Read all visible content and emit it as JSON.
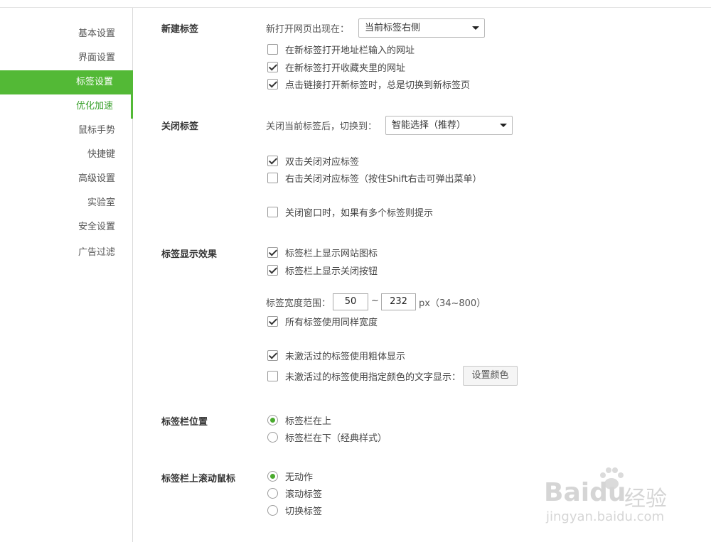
{
  "sidebar": {
    "items": [
      {
        "label": "基本设置"
      },
      {
        "label": "界面设置"
      },
      {
        "label": "标签设置"
      },
      {
        "label": "优化加速"
      },
      {
        "label": "鼠标手势"
      },
      {
        "label": "快捷键"
      },
      {
        "label": "高级设置"
      },
      {
        "label": "实验室"
      },
      {
        "label": "安全设置"
      },
      {
        "label": "广告过滤"
      }
    ],
    "active_index": 2,
    "hover_index": 3
  },
  "new_tab": {
    "title": "新建标签",
    "open_position_label": "新打开网页出现在：",
    "open_position_value": "当前标签右侧",
    "options": [
      {
        "label": "在新标签打开地址栏输入的网址",
        "checked": false
      },
      {
        "label": "在新标签打开收藏夹里的网址",
        "checked": true
      },
      {
        "label": "点击链接打开新标签时，总是切换到新标签页",
        "checked": true
      }
    ]
  },
  "close_tab": {
    "title": "关闭标签",
    "switch_label": "关闭当前标签后，切换到：",
    "switch_value": "智能选择（推荐）",
    "options": [
      {
        "label": "双击关闭对应标签",
        "checked": true
      },
      {
        "label": "右击关闭对应标签（按住Shift右击可弹出菜单）",
        "checked": false
      },
      {
        "label": "关闭窗口时，如果有多个标签则提示",
        "checked": false
      }
    ]
  },
  "display": {
    "title": "标签显示效果",
    "options_top": [
      {
        "label": "标签栏上显示网站图标",
        "checked": true
      },
      {
        "label": "标签栏上显示关闭按钮",
        "checked": true
      }
    ],
    "width_label": "标签宽度范围：",
    "width_min": "50",
    "width_sep": "~",
    "width_max": "232",
    "width_unit": "px（34~800）",
    "same_width": {
      "label": "所有标签使用同样宽度",
      "checked": true
    },
    "bold_inactive": {
      "label": "未激活过的标签使用粗体显示",
      "checked": true
    },
    "color_inactive": {
      "label": "未激活过的标签使用指定颜色的文字显示：",
      "checked": false
    },
    "set_color_button": "设置颜色"
  },
  "tabbar_position": {
    "title": "标签栏位置",
    "options": [
      {
        "label": "标签栏在上",
        "selected": true
      },
      {
        "label": "标签栏在下（经典样式）",
        "selected": false
      }
    ]
  },
  "tabbar_scroll": {
    "title": "标签栏上滚动鼠标",
    "options": [
      {
        "label": "无动作",
        "selected": true
      },
      {
        "label": "滚动标签",
        "selected": false
      },
      {
        "label": "切换标签",
        "selected": false
      }
    ]
  },
  "watermark": {
    "brand": "Bai",
    "brand2": "du",
    "product": "经验",
    "url": "jingyan.baidu.com"
  },
  "colors": {
    "accent": "#53b936",
    "radio_dot": "#4aaa2e"
  }
}
